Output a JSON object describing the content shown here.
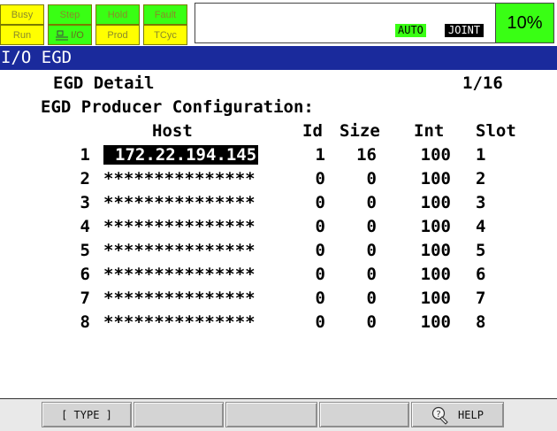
{
  "status": {
    "lamps": [
      {
        "label": "Busy",
        "color": "#ffff00"
      },
      {
        "label": "Step",
        "color": "#39ff14"
      },
      {
        "label": "Hold",
        "color": "#39ff14"
      },
      {
        "label": "Fault",
        "color": "#39ff14"
      },
      {
        "label": "Run",
        "color": "#ffff00"
      },
      {
        "label": "I/O",
        "color": "#39ff14"
      },
      {
        "label": "Prod",
        "color": "#ffff00"
      },
      {
        "label": "TCyc",
        "color": "#ffff00"
      }
    ],
    "mode": "AUTO",
    "coord": "JOINT",
    "override": "10%"
  },
  "title": "I/O EGD",
  "detail": {
    "heading": "EGD Detail",
    "page": "1/16",
    "section": "EGD Producer Configuration:",
    "columns": {
      "host": "Host",
      "id": "Id",
      "size": "Size",
      "int": "Int",
      "slot": "Slot"
    },
    "rows": [
      {
        "num": "1",
        "host": "172.22.194.145",
        "id": "1",
        "size": "16",
        "int": "100",
        "slot": "1"
      },
      {
        "num": "2",
        "host": "***************",
        "id": "0",
        "size": "0",
        "int": "100",
        "slot": "2"
      },
      {
        "num": "3",
        "host": "***************",
        "id": "0",
        "size": "0",
        "int": "100",
        "slot": "3"
      },
      {
        "num": "4",
        "host": "***************",
        "id": "0",
        "size": "0",
        "int": "100",
        "slot": "4"
      },
      {
        "num": "5",
        "host": "***************",
        "id": "0",
        "size": "0",
        "int": "100",
        "slot": "5"
      },
      {
        "num": "6",
        "host": "***************",
        "id": "0",
        "size": "0",
        "int": "100",
        "slot": "6"
      },
      {
        "num": "7",
        "host": "***************",
        "id": "0",
        "size": "0",
        "int": "100",
        "slot": "7"
      },
      {
        "num": "8",
        "host": "***************",
        "id": "0",
        "size": "0",
        "int": "100",
        "slot": "8"
      }
    ]
  },
  "fkeys": {
    "f1": "[ TYPE ]",
    "f5": "HELP",
    "f5_icon": "help-icon"
  },
  "colors": {
    "title_bar": "#1a2a9c",
    "lamp_yellow": "#ffff00",
    "lamp_green": "#39ff14"
  }
}
